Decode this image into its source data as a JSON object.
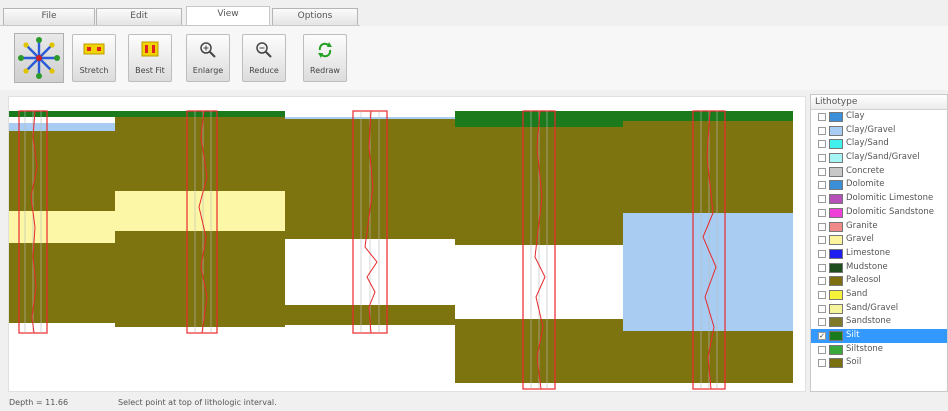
{
  "tabs": [
    {
      "label": "File",
      "active": false
    },
    {
      "label": "Edit",
      "active": false
    },
    {
      "label": "View",
      "active": true
    },
    {
      "label": "Options",
      "active": false
    }
  ],
  "toolbar": {
    "stretch_label": "Stretch",
    "best_fit_label": "Best Fit",
    "enlarge_label": "Enlarge",
    "reduce_label": "Reduce",
    "redraw_label": "Redraw"
  },
  "legend": {
    "header": "Lithotype",
    "items": [
      {
        "label": "Clay",
        "color": "#3a8fd8",
        "checked": false,
        "selected": false
      },
      {
        "label": "Clay/Gravel",
        "color": "#a9cdf2",
        "checked": false,
        "selected": false
      },
      {
        "label": "Clay/Sand",
        "color": "#3ff0ec",
        "checked": false,
        "selected": false
      },
      {
        "label": "Clay/Sand/Gravel",
        "color": "#a6f4f4",
        "checked": false,
        "selected": false
      },
      {
        "label": "Concrete",
        "color": "#c8c8c8",
        "checked": false,
        "selected": false
      },
      {
        "label": "Dolomite",
        "color": "#3a8fd8",
        "checked": false,
        "selected": false
      },
      {
        "label": "Dolomitic Limestone",
        "color": "#b550b8",
        "checked": false,
        "selected": false
      },
      {
        "label": "Dolomitic Sandstone",
        "color": "#ee3fd8",
        "checked": false,
        "selected": false
      },
      {
        "label": "Granite",
        "color": "#f08a8a",
        "checked": false,
        "selected": false
      },
      {
        "label": "Gravel",
        "color": "#fbf5a0",
        "checked": false,
        "selected": false
      },
      {
        "label": "Limestone",
        "color": "#1d1df0",
        "checked": false,
        "selected": false
      },
      {
        "label": "Mudstone",
        "color": "#1f4d1f",
        "checked": false,
        "selected": false
      },
      {
        "label": "Paleosol",
        "color": "#7d6f0f",
        "checked": false,
        "selected": false
      },
      {
        "label": "Sand",
        "color": "#f4f23a",
        "checked": false,
        "selected": false
      },
      {
        "label": "Sand/Gravel",
        "color": "#f6f49a",
        "checked": false,
        "selected": false
      },
      {
        "label": "Sandstone",
        "color": "#7f7a2a",
        "checked": false,
        "selected": false
      },
      {
        "label": "Silt",
        "color": "#1b7a1b",
        "checked": true,
        "selected": true
      },
      {
        "label": "Siltstone",
        "color": "#3aa83a",
        "checked": false,
        "selected": false
      },
      {
        "label": "Soil",
        "color": "#7a7010",
        "checked": false,
        "selected": false
      }
    ]
  },
  "colors": {
    "olive": "#7d7410",
    "silt": "#1b7a1b",
    "gravel": "#fbf7a6",
    "clay_gravel": "#a9cdf2",
    "log_red": "#e8282b"
  },
  "status": {
    "depth": "Depth = 11.66",
    "message": "Select point at top of lithologic interval."
  }
}
